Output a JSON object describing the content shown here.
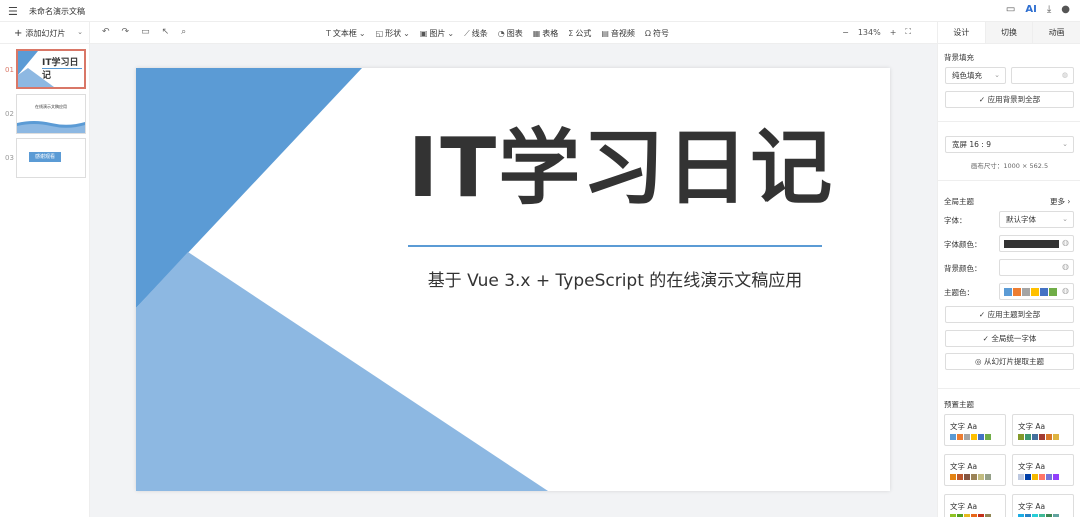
{
  "app": {
    "doc_title": "未命名演示文稿",
    "ai_label": "AI"
  },
  "toolbar": {
    "add_slide": "添加幻灯片",
    "tools": [
      {
        "icon": "textbox-icon",
        "label": "文本框",
        "dropdown": true
      },
      {
        "icon": "shape-icon",
        "label": "形状",
        "dropdown": true
      },
      {
        "icon": "image-icon",
        "label": "图片",
        "dropdown": true
      },
      {
        "icon": "line-icon",
        "label": "线条",
        "dropdown": false
      },
      {
        "icon": "chart-icon",
        "label": "图表",
        "dropdown": false
      },
      {
        "icon": "table-icon",
        "label": "表格",
        "dropdown": false
      },
      {
        "icon": "formula-icon",
        "label": "公式",
        "dropdown": false
      },
      {
        "icon": "media-icon",
        "label": "音视频",
        "dropdown": false
      },
      {
        "icon": "symbol-icon",
        "label": "符号",
        "dropdown": false
      }
    ],
    "zoom": "134%"
  },
  "thumbnails": {
    "numbers": [
      "01",
      "02",
      "03"
    ],
    "t1_title": "IT学习日记",
    "t2_title": "在线演示文稿应用",
    "t3_title": "感谢观看"
  },
  "slide": {
    "title": "IT学习日记",
    "subtitle": "基于 Vue 3.x + TypeScript 的在线演示文稿应用",
    "accent_dark": "#5b9bd5",
    "accent_light": "#8db8e2"
  },
  "panel": {
    "tabs": [
      "设计",
      "切换",
      "动画"
    ],
    "bg_fill_label": "背景填充",
    "fill_type": "纯色填充",
    "apply_bg_all": "应用背景到全部",
    "ratio": "宽屏 16 : 9",
    "canvas_size": "画布尺寸：1000 × 562.5",
    "global_theme": "全局主题",
    "more": "更多",
    "font_label": "字体：",
    "font_value": "默认字体",
    "font_color_label": "字体颜色：",
    "bg_color_label": "背景颜色：",
    "theme_color_label": "主题色：",
    "theme_colors": [
      "#5b9bd5",
      "#ed7d31",
      "#a5a5a5",
      "#ffc000",
      "#4472c4",
      "#70ad47"
    ],
    "apply_theme_all": "应用主题到全部",
    "unify_font": "全局统一字体",
    "extract_theme": "从幻灯片提取主题",
    "preset_label": "预置主题",
    "preset_text": "文字 Aa",
    "presets": [
      [
        "#5b9bd5",
        "#ed7d31",
        "#a5a5a5",
        "#ffc000",
        "#4472c4",
        "#70ad47"
      ],
      [
        "#83992a",
        "#3c9770",
        "#44709d",
        "#a23b32",
        "#d87728",
        "#deb340"
      ],
      [
        "#e48312",
        "#bd582c",
        "#865640",
        "#9b8357",
        "#c2bc80",
        "#94a088"
      ],
      [
        "#bdc8df",
        "#003fa9",
        "#f5ba00",
        "#ff7567",
        "#7676d9",
        "#923ffc"
      ],
      [
        "#90c225",
        "#54a121",
        "#e6b91e",
        "#e86618",
        "#c42f19",
        "#918655"
      ],
      [
        "#1cade4",
        "#2683c6",
        "#27ced7",
        "#42ba97",
        "#3e8853",
        "#62a39f"
      ]
    ]
  }
}
